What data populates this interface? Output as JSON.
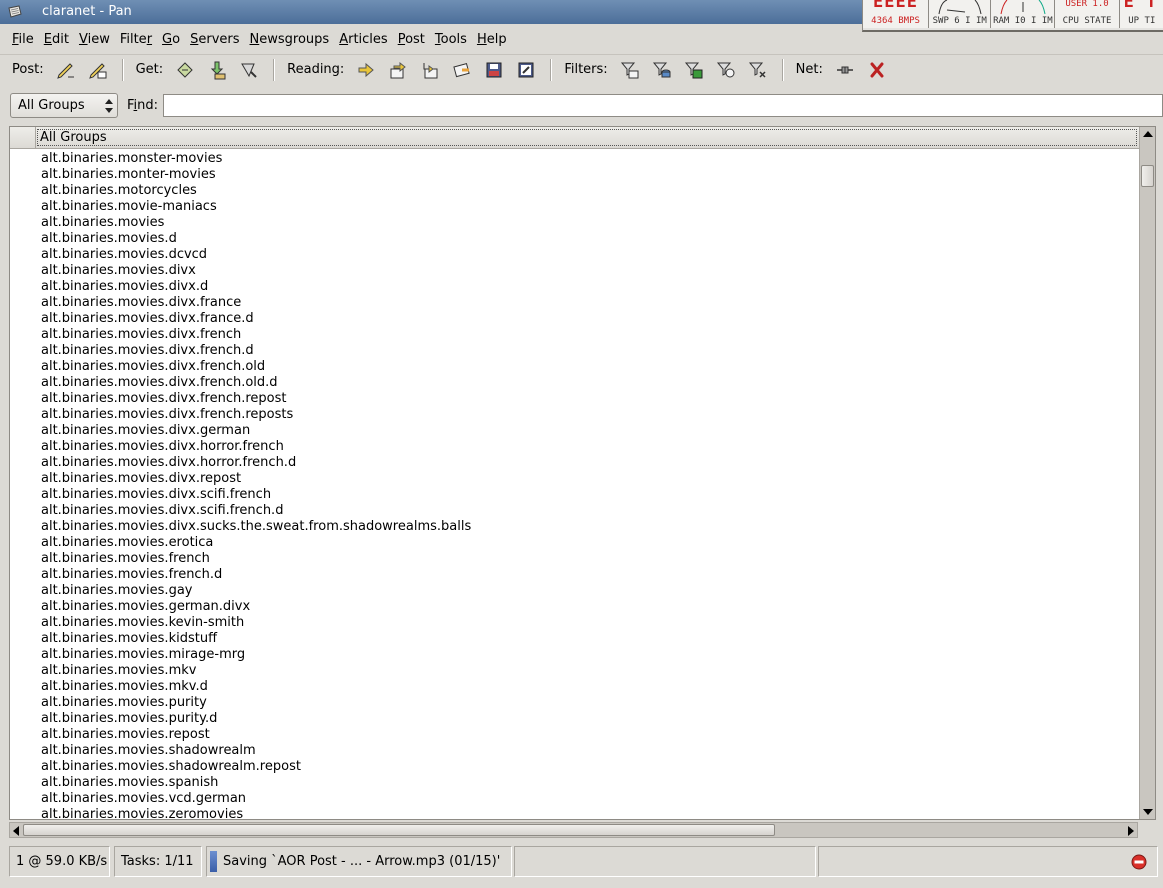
{
  "window": {
    "title": "claranet - Pan"
  },
  "monitors": [
    {
      "name": "net",
      "value": "ЕЕЕЕ",
      "label": "4364 BMPS"
    },
    {
      "name": "swap",
      "label": "SWP 6 I IM"
    },
    {
      "name": "ram",
      "label": "RAM  I0 I IM"
    },
    {
      "name": "cpu",
      "top_label": "USER  1.0",
      "label": "CPU STATE"
    },
    {
      "name": "uptime",
      "label": "UP TI"
    }
  ],
  "menubar": {
    "items": [
      {
        "pre": "",
        "u": "F",
        "post": "ile"
      },
      {
        "pre": "",
        "u": "E",
        "post": "dit"
      },
      {
        "pre": "",
        "u": "V",
        "post": "iew"
      },
      {
        "pre": "Filte",
        "u": "r",
        "post": ""
      },
      {
        "pre": "",
        "u": "G",
        "post": "o"
      },
      {
        "pre": "",
        "u": "S",
        "post": "ervers"
      },
      {
        "pre": "",
        "u": "N",
        "post": "ewsgroups"
      },
      {
        "pre": "",
        "u": "A",
        "post": "rticles"
      },
      {
        "pre": "",
        "u": "P",
        "post": "ost"
      },
      {
        "pre": "",
        "u": "T",
        "post": "ools"
      },
      {
        "pre": "",
        "u": "H",
        "post": "elp"
      }
    ]
  },
  "toolbar": {
    "post_label": "Post:",
    "get_label": "Get:",
    "reading_label": "Reading:",
    "filters_label": "Filters:",
    "net_label": "Net:"
  },
  "filter": {
    "group_selected": "All Groups",
    "find_pre": "F",
    "find_u": "i",
    "find_post": "nd:",
    "find_value": ""
  },
  "grouplist": {
    "header": "All Groups",
    "rows": [
      "alt.binaries.monster-movies",
      "alt.binaries.monter-movies",
      "alt.binaries.motorcycles",
      "alt.binaries.movie-maniacs",
      "alt.binaries.movies",
      "alt.binaries.movies.d",
      "alt.binaries.movies.dcvcd",
      "alt.binaries.movies.divx",
      "alt.binaries.movies.divx.d",
      "alt.binaries.movies.divx.france",
      "alt.binaries.movies.divx.france.d",
      "alt.binaries.movies.divx.french",
      "alt.binaries.movies.divx.french.d",
      "alt.binaries.movies.divx.french.old",
      "alt.binaries.movies.divx.french.old.d",
      "alt.binaries.movies.divx.french.repost",
      "alt.binaries.movies.divx.french.reposts",
      "alt.binaries.movies.divx.german",
      "alt.binaries.movies.divx.horror.french",
      "alt.binaries.movies.divx.horror.french.d",
      "alt.binaries.movies.divx.repost",
      "alt.binaries.movies.divx.scifi.french",
      "alt.binaries.movies.divx.scifi.french.d",
      "alt.binaries.movies.divx.sucks.the.sweat.from.shadowrealms.balls",
      "alt.binaries.movies.erotica",
      "alt.binaries.movies.french",
      "alt.binaries.movies.french.d",
      "alt.binaries.movies.gay",
      "alt.binaries.movies.german.divx",
      "alt.binaries.movies.kevin-smith",
      "alt.binaries.movies.kidstuff",
      "alt.binaries.movies.mirage-mrg",
      "alt.binaries.movies.mkv",
      "alt.binaries.movies.mkv.d",
      "alt.binaries.movies.purity",
      "alt.binaries.movies.purity.d",
      "alt.binaries.movies.repost",
      "alt.binaries.movies.shadowrealm",
      "alt.binaries.movies.shadowrealm.repost",
      "alt.binaries.movies.spanish",
      "alt.binaries.movies.vcd.german",
      "alt.binaries.movies.zeromovies"
    ]
  },
  "statusbar": {
    "speed": "1 @ 59.0 KB/s",
    "tasks": "Tasks: 1/11",
    "progress": "Saving `AOR Post - ... - Arrow.mp3 (01/15)'"
  }
}
